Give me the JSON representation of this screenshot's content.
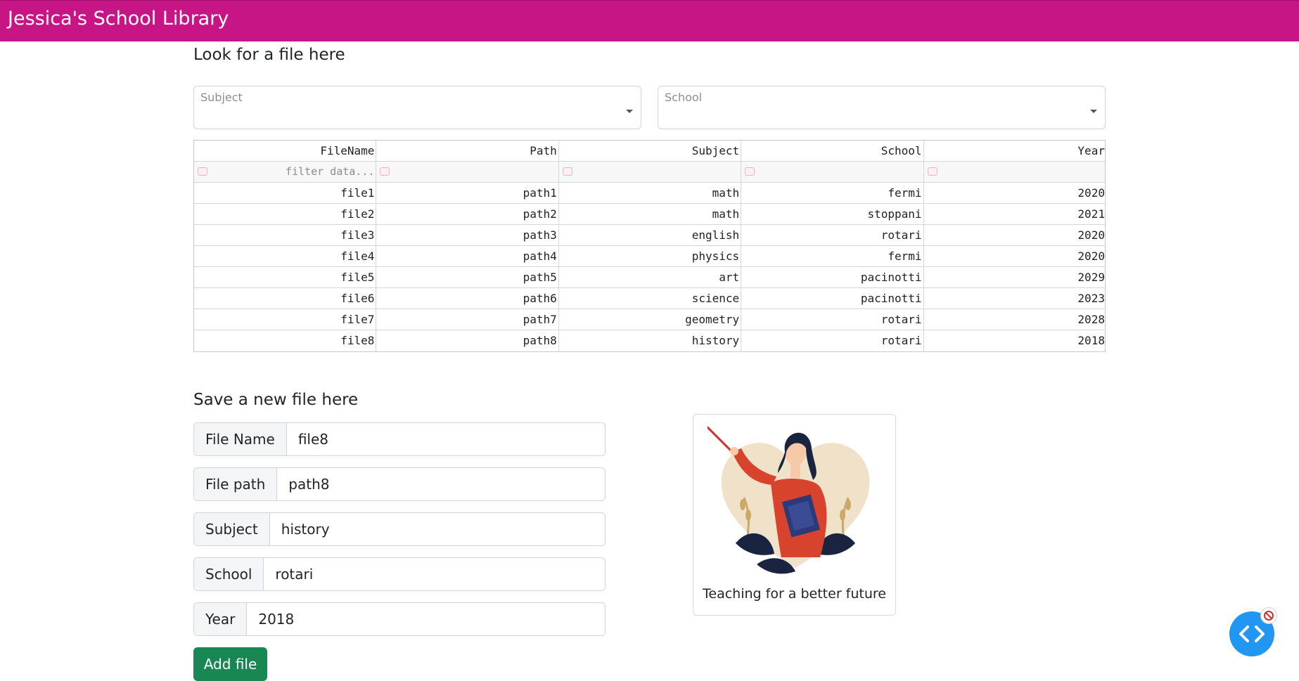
{
  "header": {
    "title": "Jessica's School Library",
    "bg_color": "#c71585"
  },
  "search": {
    "title": "Look for a file here",
    "subject_label": "Subject",
    "school_label": "School"
  },
  "table": {
    "columns": [
      "FileName",
      "Path",
      "Subject",
      "School",
      "Year"
    ],
    "filter_placeholder": "filter data...",
    "rows": [
      [
        "file1",
        "path1",
        "math",
        "fermi",
        "2020"
      ],
      [
        "file2",
        "path2",
        "math",
        "stoppani",
        "2021"
      ],
      [
        "file3",
        "path3",
        "english",
        "rotari",
        "2020"
      ],
      [
        "file4",
        "path4",
        "physics",
        "fermi",
        "2020"
      ],
      [
        "file5",
        "path5",
        "art",
        "pacinotti",
        "2029"
      ],
      [
        "file6",
        "path6",
        "science",
        "pacinotti",
        "2023"
      ],
      [
        "file7",
        "path7",
        "geometry",
        "rotari",
        "2028"
      ],
      [
        "file8",
        "path8",
        "history",
        "rotari",
        "2018"
      ]
    ]
  },
  "form": {
    "title": "Save a new file here",
    "fields": [
      {
        "label": "File Name",
        "value": "file8"
      },
      {
        "label": "File path",
        "value": "path8"
      },
      {
        "label": "Subject",
        "value": "history"
      },
      {
        "label": "School",
        "value": "rotari"
      },
      {
        "label": "Year",
        "value": "2018"
      }
    ],
    "submit_label": "Add file",
    "submit_color": "#198754"
  },
  "card": {
    "caption": "Teaching for a better future",
    "image_icon": "teacher-illustration"
  },
  "fab": {
    "icon": "code-icon",
    "badge_icon": "blocked-icon",
    "color": "#2196f3"
  }
}
